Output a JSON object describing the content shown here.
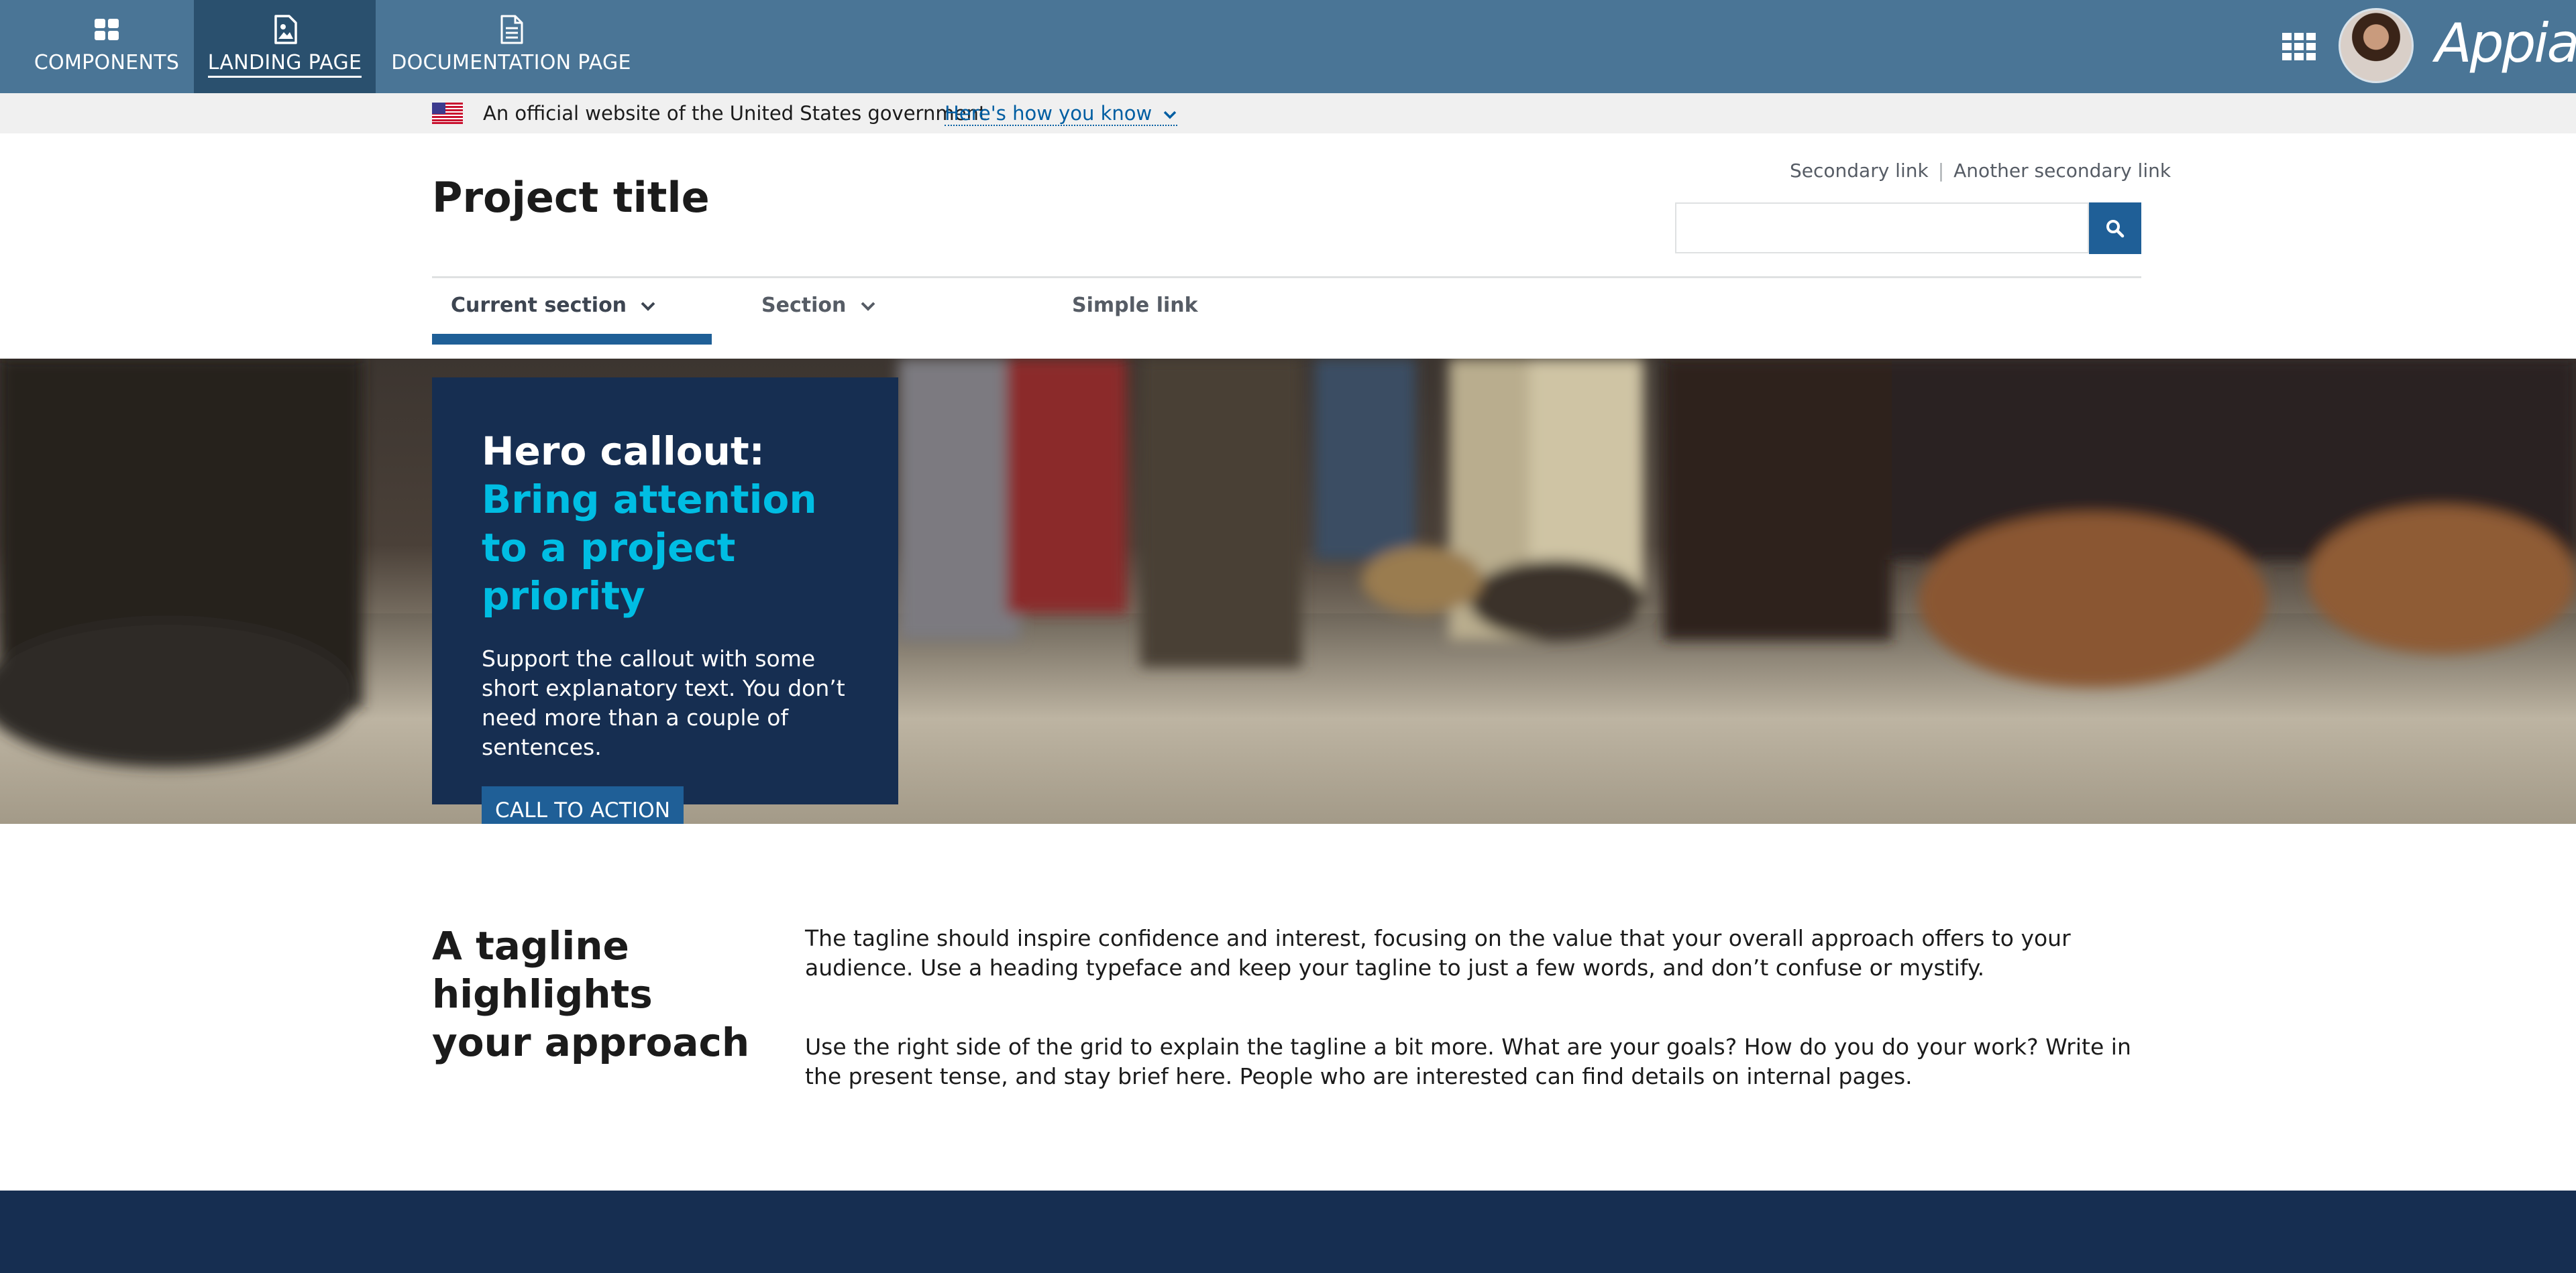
{
  "appbar": {
    "tabs": [
      {
        "label": "COMPONENTS",
        "icon": "grid-tiles-icon"
      },
      {
        "label": "LANDING PAGE",
        "icon": "image-file-icon",
        "active": true
      },
      {
        "label": "DOCUMENTATION PAGE",
        "icon": "document-icon"
      }
    ],
    "brand": "Appian",
    "colors": {
      "bar": "#4a7596",
      "active_tab": "#2a506e"
    }
  },
  "gov_banner": {
    "text": "An official website of the United States government",
    "link": "Here's how you know"
  },
  "header": {
    "project_title": "Project title",
    "secondary_links": [
      "Secondary link",
      "Another secondary link"
    ],
    "search": {
      "value": "",
      "placeholder": ""
    }
  },
  "nav": {
    "items": [
      {
        "label": "Current section",
        "has_dropdown": true,
        "current": true
      },
      {
        "label": "Section",
        "has_dropdown": true
      },
      {
        "label": "Simple link",
        "has_dropdown": false
      }
    ]
  },
  "hero": {
    "heading_line1": "Hero callout:",
    "heading_accent": "Bring attention to a project priority",
    "body": "Support the callout with some short explanatory text. You don’t need more than a couple of sentences.",
    "cta": "CALL TO ACTION",
    "colors": {
      "card": "#162e51",
      "accent": "#00bde3",
      "button": "#1f5f97"
    }
  },
  "tagline": {
    "heading": "A tagline highlights your approach",
    "paragraphs": [
      "The tagline should inspire confidence and interest, focusing on the value that your overall approach offers to your audience. Use a heading typeface and keep your tagline to just a few words, and don’t confuse or mystify.",
      "Use the right side of the grid to explain the tagline a bit more. What are your goals? How do you do your work? Write in the present tense, and stay brief here. People who are interested can find details on internal pages."
    ]
  }
}
